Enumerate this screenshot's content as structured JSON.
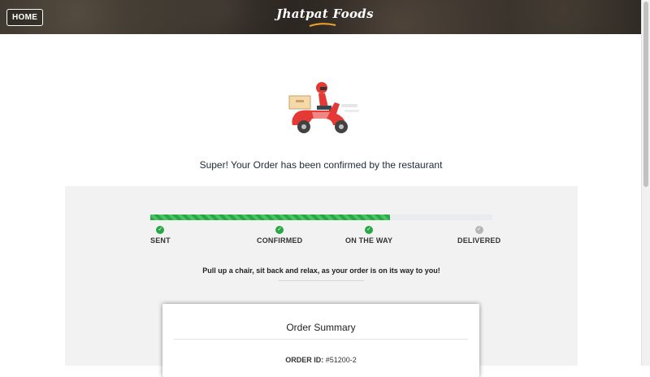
{
  "header": {
    "home_label": "HOME",
    "brand": "Jhatpat Foods"
  },
  "status": {
    "message": "Super! Your Order has been confirmed by the restaurant",
    "progress_fraction": 0.7,
    "steps": [
      {
        "label": "SENT",
        "done": true
      },
      {
        "label": "CONFIRMED",
        "done": true
      },
      {
        "label": "ON THE WAY",
        "done": true
      },
      {
        "label": "DELIVERED",
        "done": false
      }
    ],
    "relax_message": "Pull up a chair, sit back and relax, as your order is on its way to you!"
  },
  "summary": {
    "title": "Order Summary",
    "order_id_label": "ORDER ID:",
    "order_id_value": "#51200-2"
  },
  "colors": {
    "progress": "#28a745",
    "pending": "#b5b5b5",
    "accent_red": "#e53935"
  },
  "icons": {
    "scooter": "delivery-scooter-icon",
    "step_done": "check-circle-icon",
    "step_pending": "check-circle-gray-icon"
  }
}
